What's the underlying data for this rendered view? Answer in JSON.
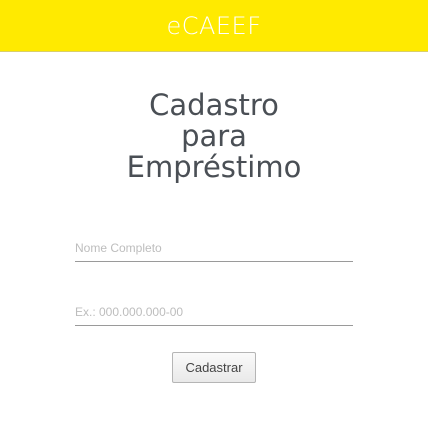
{
  "header": {
    "title": "eCAEEF",
    "background_color": "#ffea00",
    "text_color": "#ffffff"
  },
  "main": {
    "title_lines": [
      "Cadastro",
      "para",
      "Empréstimo"
    ],
    "form": {
      "full_name": {
        "value": "",
        "placeholder": "Nome Completo"
      },
      "cpf": {
        "value": "",
        "placeholder": "Ex.: 000.000.000-00"
      },
      "submit_label": "Cadastrar"
    }
  }
}
